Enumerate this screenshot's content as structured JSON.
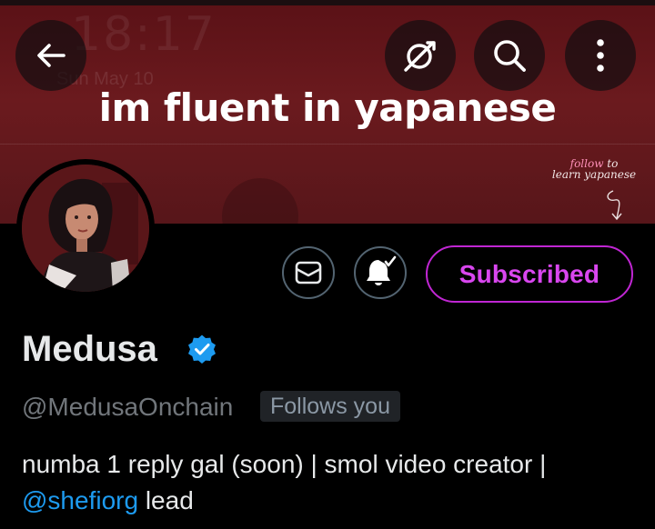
{
  "header": {
    "banner_headline": "im fluent in yapanese",
    "banner_note_line1_pink": "follow",
    "banner_note_line1_rest": " to",
    "banner_note_line2": "learn yapanese",
    "banner_ghost_time": "18:17",
    "banner_ghost_date": "Sun May 10",
    "banner_color": "#6b1a1e"
  },
  "nav": {
    "back_icon": "arrow-left-icon",
    "grok_icon": "grok-icon",
    "search_icon": "search-icon",
    "more_icon": "more-vertical-icon"
  },
  "actions": {
    "message_icon": "envelope-icon",
    "notify_icon": "bell-check-icon",
    "subscribed_label": "Subscribed",
    "subscribed_color": "#d946ef"
  },
  "profile": {
    "name": "Medusa",
    "verified_icon": "verified-badge-icon",
    "verified_color": "#1d9bf0",
    "handle": "@MedusaOnchain",
    "follows_you": "Follows you",
    "bio_text": "numba 1 reply gal (soon) | smol video creator |",
    "bio_mention": "@shefiorg",
    "bio_suffix": " lead"
  }
}
